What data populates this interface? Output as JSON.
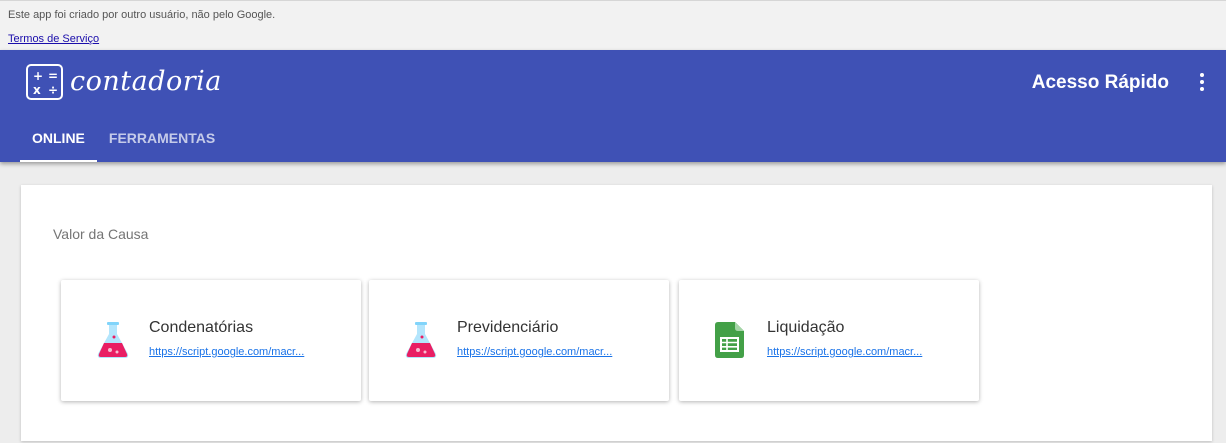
{
  "gbar": {
    "message": "Este app foi criado por outro usuário, não pelo Google.",
    "terms_link": "Termos de Serviço"
  },
  "header": {
    "logo_symbols": [
      "+",
      "=",
      "x",
      "÷"
    ],
    "app_name": "contadoria",
    "quick_access": "Acesso Rápido",
    "menu_icon": "more-vert-icon"
  },
  "tabs": [
    {
      "label": "ONLINE",
      "active": true
    },
    {
      "label": "FERRAMENTAS",
      "active": false
    }
  ],
  "section": {
    "title": "Valor da Causa",
    "cards": [
      {
        "title": "Condenatórias",
        "link": "https://script.google.com/macr...",
        "icon": "flask-icon"
      },
      {
        "title": "Previdenciário",
        "link": "https://script.google.com/macr...",
        "icon": "flask-icon"
      },
      {
        "title": "Liquidação",
        "link": "https://script.google.com/macr...",
        "icon": "spreadsheet-icon"
      }
    ]
  },
  "colors": {
    "primary": "#3f51b5",
    "flask_liquid": "#e91e63",
    "flask_glass": "#b3e5fc",
    "sheets_green": "#43a047"
  }
}
